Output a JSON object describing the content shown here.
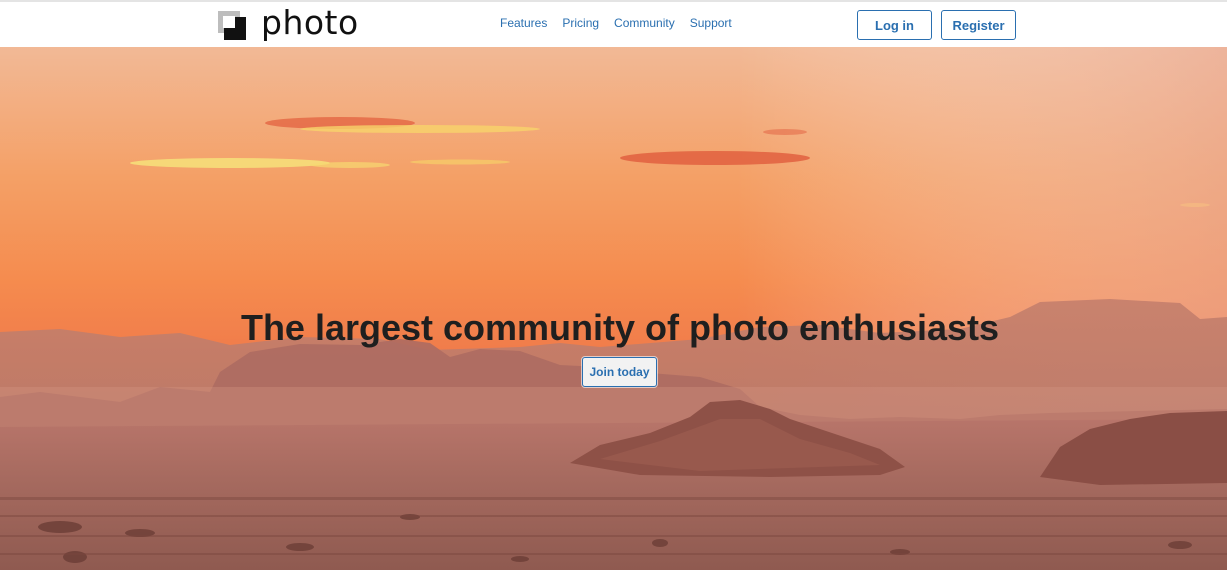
{
  "brand": {
    "name": "photo",
    "logo_icon": "square-photo-logo-icon"
  },
  "nav": {
    "links": [
      {
        "label": "Features"
      },
      {
        "label": "Pricing"
      },
      {
        "label": "Community"
      },
      {
        "label": "Support"
      }
    ]
  },
  "auth": {
    "login_label": "Log in",
    "register_label": "Register"
  },
  "hero": {
    "title": "The largest community of photo enthusiasts",
    "cta_label": "Join today",
    "background": "desert-sunset-image"
  },
  "colors": {
    "accent": "#2a6fb0",
    "sky_top": "#f3b790",
    "sky_mid": "#f6904a",
    "desert": "#a9695f"
  }
}
